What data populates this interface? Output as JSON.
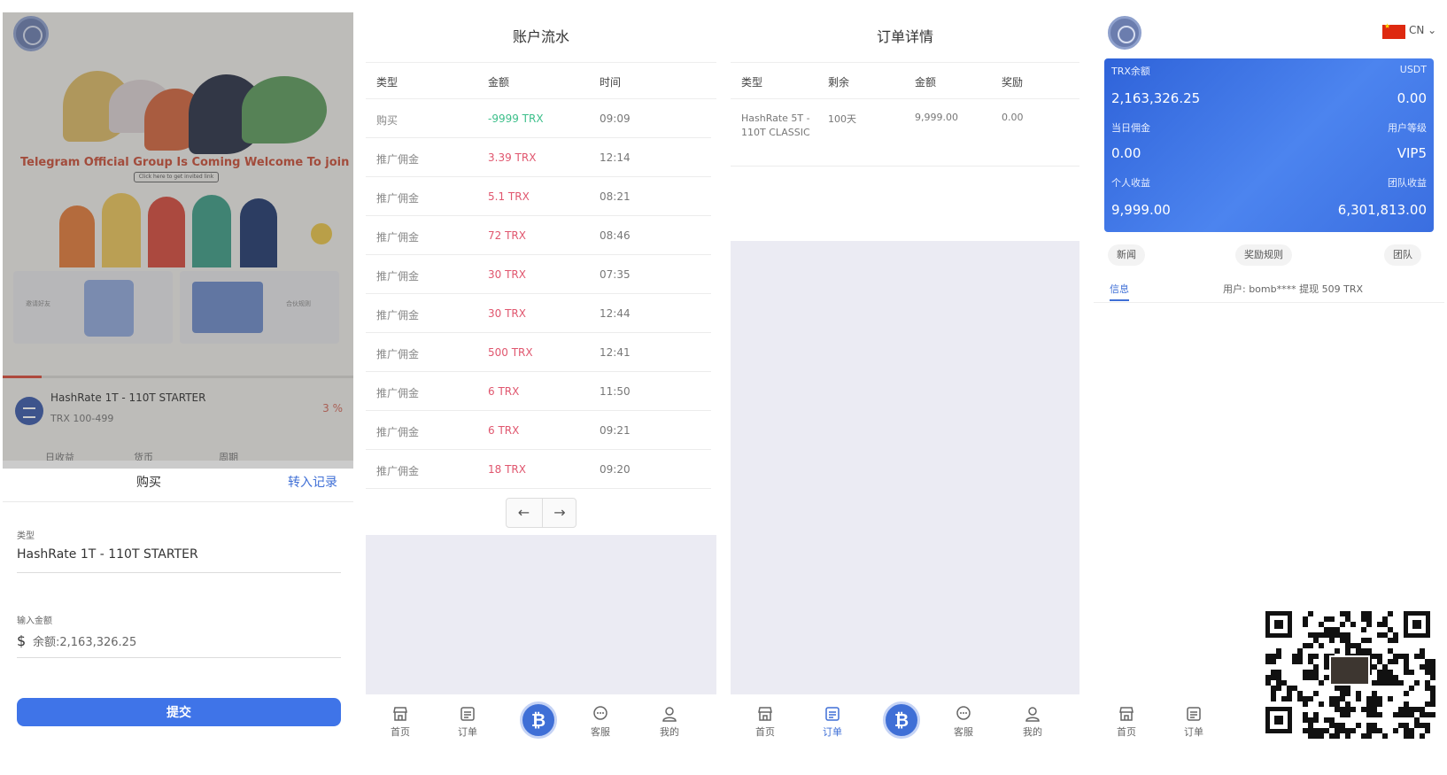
{
  "panel1": {
    "banner": {
      "text": "Telegram Official Group  Is Coming Welcome To join Us",
      "link": "Click here to get invited link",
      "tile_left_label": "邀请好友",
      "tile_right_label": "合伙规则"
    },
    "product": {
      "name": "HashRate 1T - 110T STARTER",
      "range": "TRX 100-499",
      "percent": "3 %",
      "progress": 0.11
    },
    "tabs": [
      "日收益",
      "货币",
      "周期"
    ],
    "sheet": {
      "title": "购买",
      "link": "转入记录",
      "type_label": "类型",
      "type_value": "HashRate 1T - 110T STARTER",
      "amount_label": "输入金额",
      "currency_symbol": "$",
      "amount_placeholder": "余额:2,163,326.25",
      "submit": "提交"
    }
  },
  "panel2": {
    "title": "账户流水",
    "columns": [
      "类型",
      "金额",
      "时间"
    ],
    "rows": [
      {
        "type": "购买",
        "amount": "-9999 TRX",
        "time": "09:09",
        "sign": "neg"
      },
      {
        "type": "推广佣金",
        "amount": "3.39 TRX",
        "time": "12:14",
        "sign": "pos"
      },
      {
        "type": "推广佣金",
        "amount": "5.1 TRX",
        "time": "08:21",
        "sign": "pos"
      },
      {
        "type": "推广佣金",
        "amount": "72 TRX",
        "time": "08:46",
        "sign": "pos"
      },
      {
        "type": "推广佣金",
        "amount": "30 TRX",
        "time": "07:35",
        "sign": "pos"
      },
      {
        "type": "推广佣金",
        "amount": "30 TRX",
        "time": "12:44",
        "sign": "pos"
      },
      {
        "type": "推广佣金",
        "amount": "500 TRX",
        "time": "12:41",
        "sign": "pos"
      },
      {
        "type": "推广佣金",
        "amount": "6 TRX",
        "time": "11:50",
        "sign": "pos"
      },
      {
        "type": "推广佣金",
        "amount": "6 TRX",
        "time": "09:21",
        "sign": "pos"
      },
      {
        "type": "推广佣金",
        "amount": "18 TRX",
        "time": "09:20",
        "sign": "pos"
      }
    ],
    "pager_prev": "←",
    "pager_next": "→"
  },
  "panel3": {
    "title": "订单详情",
    "columns": [
      "类型",
      "剩余",
      "金额",
      "奖励"
    ],
    "row": {
      "type": "HashRate 5T - 110T CLASSIC",
      "remaining": "100天",
      "amount": "9,999.00",
      "reward": "0.00"
    }
  },
  "panel4": {
    "language": "CN",
    "card": {
      "trx_balance_label": "TRX余额",
      "usdt_label": "USDT",
      "trx_balance": "2,163,326.25",
      "usdt_balance": "0.00",
      "daily_commission_label": "当日佣金",
      "user_level_label": "用户等级",
      "daily_commission": "0.00",
      "user_level": "VIP5",
      "personal_income_label": "个人收益",
      "team_income_label": "团队收益",
      "personal_income": "9,999.00",
      "team_income": "6,301,813.00"
    },
    "pills": [
      "新闻",
      "奖励规则",
      "团队"
    ],
    "info_tab": "信息",
    "info_text": "用户: bomb**** 提现 509 TRX"
  },
  "nav": {
    "home": "首页",
    "orders": "订单",
    "center_symbol": "₿",
    "service": "客服",
    "mine": "我的"
  },
  "colors": {
    "accent": "#3f6fd6",
    "negative_amount": "#3cbf8a",
    "positive_amount": "#e0566e"
  }
}
